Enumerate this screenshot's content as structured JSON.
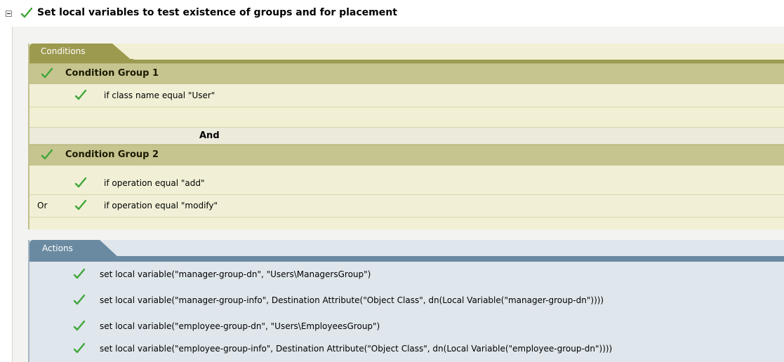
{
  "rule": {
    "title": "Set local variables to test existence of groups and for placement",
    "toggle_icon": "collapse-minus-icon",
    "status_icon": "checkmark-icon"
  },
  "colors": {
    "check_green": "#3fa63a",
    "conditions_accent": "#9c9a4e",
    "conditions_group_header": "#c6c48f",
    "actions_accent": "#6a8aa1"
  },
  "conditions": {
    "tab_label": "Conditions",
    "groups": [
      {
        "label": "Condition Group 1",
        "items": [
          {
            "prefix": "",
            "text": "if class name equal \"User\""
          }
        ]
      },
      {
        "label": "Condition Group 2",
        "items": [
          {
            "prefix": "",
            "text": "if operation equal \"add\""
          },
          {
            "prefix": "Or",
            "text": "if operation equal \"modify\""
          }
        ]
      }
    ],
    "joiner": "And"
  },
  "actions": {
    "tab_label": "Actions",
    "items": [
      "set local variable(\"manager-group-dn\", \"Users\\ManagersGroup\")",
      "set local variable(\"manager-group-info\", Destination Attribute(\"Object Class\", dn(Local Variable(\"manager-group-dn\"))))",
      "set local variable(\"employee-group-dn\", \"Users\\EmployeesGroup\")",
      "set local variable(\"employee-group-info\", Destination Attribute(\"Object Class\", dn(Local Variable(\"employee-group-dn\"))))"
    ]
  }
}
